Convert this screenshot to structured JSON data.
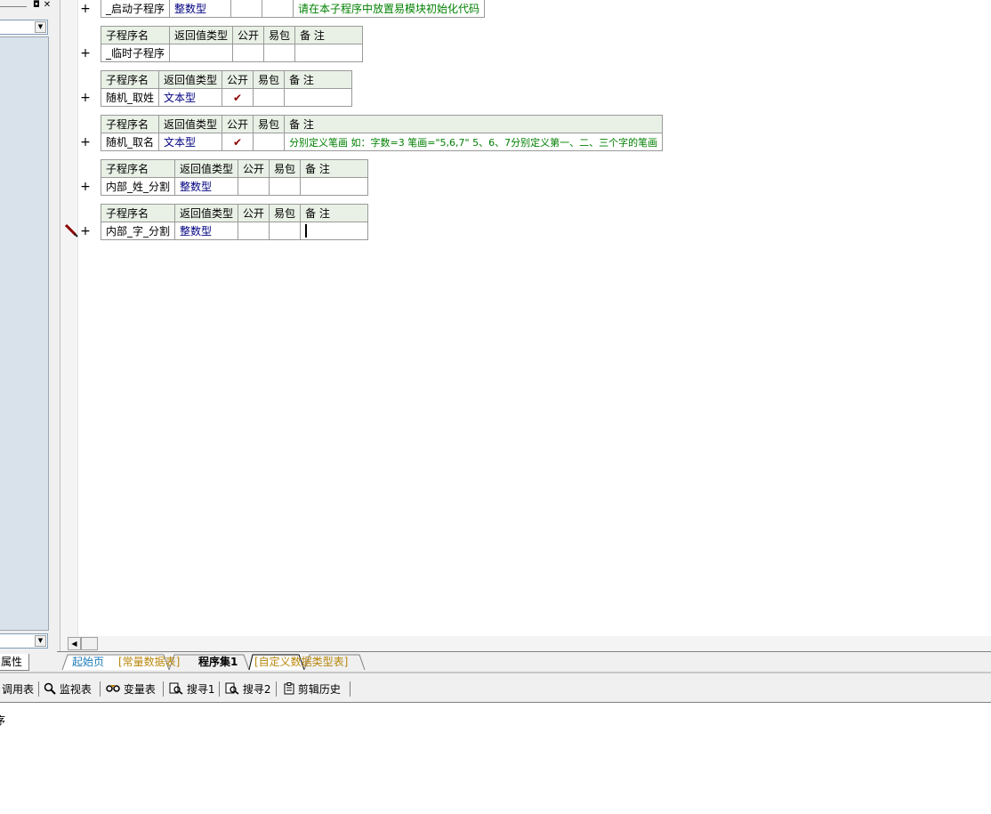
{
  "left_panel": {
    "tab_label": "属性",
    "pin_glyph": "◘",
    "close_glyph": "✕"
  },
  "subroutines": [
    {
      "headers": [
        "子程序名",
        "返回值类型",
        "公开",
        "易包",
        "备 注"
      ],
      "name": "_启动子程序",
      "type": "整数型",
      "public": "",
      "easy_pack": "",
      "note": "请在本子程序中放置易模块初始化代码",
      "expand": "+"
    },
    {
      "headers": [
        "子程序名",
        "返回值类型",
        "公开",
        "易包",
        "备 注"
      ],
      "name": "_临时子程序",
      "type": "",
      "public": "",
      "easy_pack": "",
      "note": "",
      "expand": "+"
    },
    {
      "headers": [
        "子程序名",
        "返回值类型",
        "公开",
        "易包",
        "备 注"
      ],
      "name": "随机_取姓",
      "type": "文本型",
      "public": "✔",
      "easy_pack": "",
      "note": "",
      "expand": "+"
    },
    {
      "headers": [
        "子程序名",
        "返回值类型",
        "公开",
        "易包",
        "备 注"
      ],
      "name": "随机_取名",
      "type": "文本型",
      "public": "✔",
      "easy_pack": "",
      "note": "分别定义笔画 如：字数=3  笔画=\"5,6,7\"     5、6、7分别定义第一、二、三个字的笔画",
      "expand": "+"
    },
    {
      "headers": [
        "子程序名",
        "返回值类型",
        "公开",
        "易包",
        "备 注"
      ],
      "name": "内部_姓_分割",
      "type": "整数型",
      "public": "",
      "easy_pack": "",
      "note": "",
      "expand": "+"
    },
    {
      "headers": [
        "子程序名",
        "返回值类型",
        "公开",
        "易包",
        "备 注"
      ],
      "name": "内部_字_分割",
      "type": "整数型",
      "public": "",
      "easy_pack": "",
      "note": "",
      "expand": "+"
    }
  ],
  "tabs": [
    {
      "label": "起始页",
      "color": "#1a7ab8"
    },
    {
      "label": "[常量数据表]",
      "color": "#b8860b"
    },
    {
      "label": "程序集1",
      "color": "#000000"
    },
    {
      "label": "[自定义数据类型表]",
      "color": "#b8860b"
    }
  ],
  "bottom_toolbar": [
    {
      "label": "调用表",
      "icon": "call-table-icon"
    },
    {
      "label": "监视表",
      "icon": "magnifier-icon"
    },
    {
      "label": "变量表",
      "icon": "variables-icon"
    },
    {
      "label": "搜寻1",
      "icon": "search-doc-icon"
    },
    {
      "label": "搜寻2",
      "icon": "search-doc-icon"
    },
    {
      "label": "剪辑历史",
      "icon": "clipboard-icon"
    }
  ],
  "output": {
    "text": "序"
  },
  "colors": {
    "header_bg": "#e9f1e6",
    "type_text": "#000080",
    "note_text": "#008000",
    "check": "#8b0000"
  }
}
